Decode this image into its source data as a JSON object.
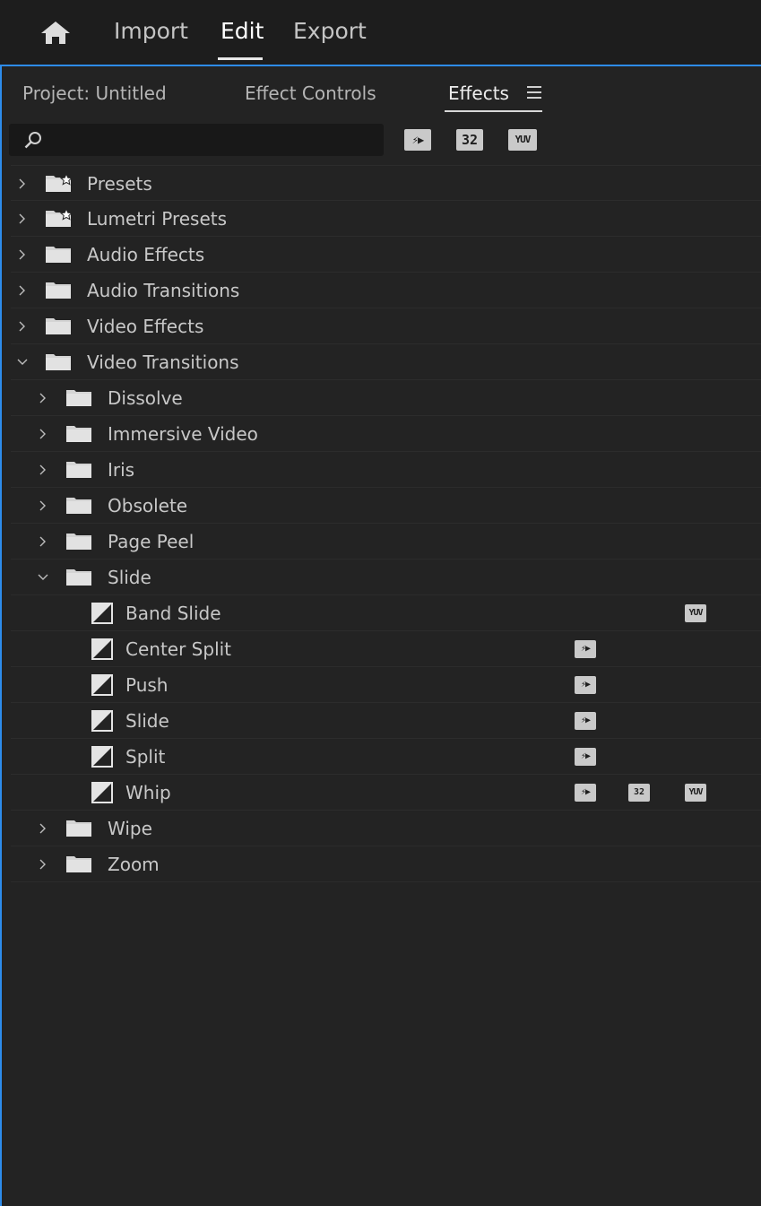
{
  "workspace": {
    "home_icon": "home-icon",
    "tabs": [
      {
        "label": "Import"
      },
      {
        "label": "Edit",
        "active": true
      },
      {
        "label": "Export"
      }
    ]
  },
  "panel": {
    "tabs": [
      {
        "label": "Project: Untitled"
      },
      {
        "label": "Effect Controls"
      },
      {
        "label": "Effects",
        "active": true
      }
    ],
    "menu_icon": "hamburger-menu-icon",
    "search": {
      "value": "",
      "placeholder": ""
    },
    "filter_buttons": [
      {
        "name": "accelerated-effects-filter",
        "label": "⚡▶"
      },
      {
        "name": "32bit-effects-filter",
        "label": "32"
      },
      {
        "name": "yuv-effects-filter",
        "label": "YUV"
      }
    ]
  },
  "tree": [
    {
      "label": "Presets",
      "level": 0,
      "type": "preset-folder",
      "expanded": false
    },
    {
      "label": "Lumetri Presets",
      "level": 0,
      "type": "preset-folder",
      "expanded": false
    },
    {
      "label": "Audio Effects",
      "level": 0,
      "type": "folder",
      "expanded": false
    },
    {
      "label": "Audio Transitions",
      "level": 0,
      "type": "folder",
      "expanded": false
    },
    {
      "label": "Video Effects",
      "level": 0,
      "type": "folder",
      "expanded": false
    },
    {
      "label": "Video Transitions",
      "level": 0,
      "type": "folder",
      "expanded": true
    },
    {
      "label": "Dissolve",
      "level": 1,
      "type": "folder",
      "expanded": false
    },
    {
      "label": "Immersive Video",
      "level": 1,
      "type": "folder",
      "expanded": false
    },
    {
      "label": "Iris",
      "level": 1,
      "type": "folder",
      "expanded": false
    },
    {
      "label": "Obsolete",
      "level": 1,
      "type": "folder",
      "expanded": false
    },
    {
      "label": "Page Peel",
      "level": 1,
      "type": "folder",
      "expanded": false
    },
    {
      "label": "Slide",
      "level": 1,
      "type": "folder",
      "expanded": true
    },
    {
      "label": "Band Slide",
      "level": 2,
      "type": "transition",
      "accel": false,
      "b32": false,
      "yuv": true
    },
    {
      "label": "Center Split",
      "level": 2,
      "type": "transition",
      "accel": true,
      "b32": false,
      "yuv": false
    },
    {
      "label": "Push",
      "level": 2,
      "type": "transition",
      "accel": true,
      "b32": false,
      "yuv": false
    },
    {
      "label": "Slide",
      "level": 2,
      "type": "transition",
      "accel": true,
      "b32": false,
      "yuv": false
    },
    {
      "label": "Split",
      "level": 2,
      "type": "transition",
      "accel": true,
      "b32": false,
      "yuv": false
    },
    {
      "label": "Whip",
      "level": 2,
      "type": "transition",
      "accel": true,
      "b32": true,
      "yuv": true
    },
    {
      "label": "Wipe",
      "level": 1,
      "type": "folder",
      "expanded": false
    },
    {
      "label": "Zoom",
      "level": 1,
      "type": "folder",
      "expanded": false
    }
  ],
  "colors": {
    "accent": "#2d8ceb",
    "background": "#232323",
    "topbar": "#1d1d1d"
  }
}
